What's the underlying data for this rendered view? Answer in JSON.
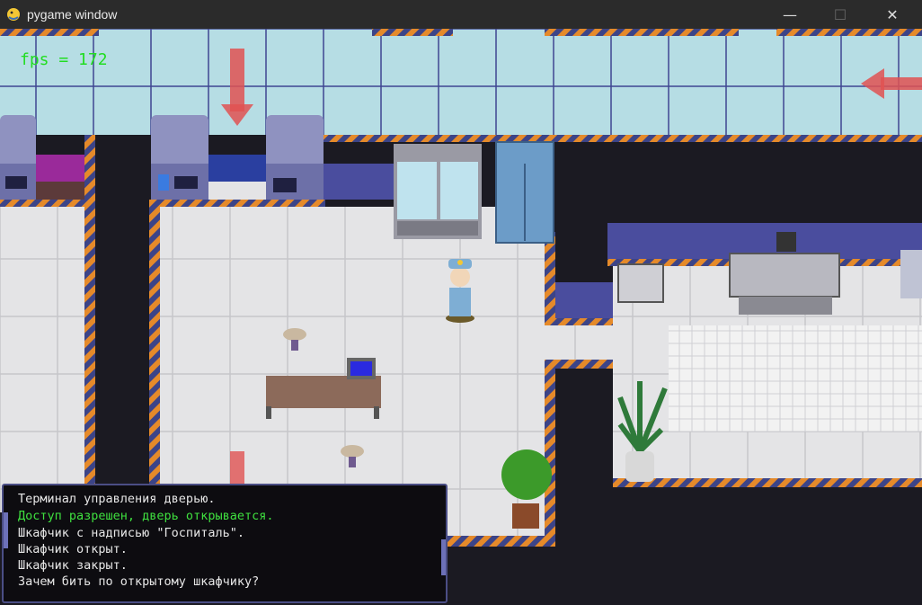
{
  "window": {
    "title": "pygame window",
    "minimize_glyph": "—",
    "maximize_glyph": "☐",
    "close_glyph": "✕"
  },
  "hud": {
    "fps_text": "fps = 172"
  },
  "console": {
    "lines": [
      {
        "text": "Терминал управления дверью.",
        "color": "#e6e6e6"
      },
      {
        "text": "Доступ разрешен, дверь открывается.",
        "color": "#3fe03f"
      },
      {
        "text": "Шкафчик с надписью \"Госпиталь\".",
        "color": "#e6e6e6"
      },
      {
        "text": "Шкафчик открыт.",
        "color": "#e6e6e6"
      },
      {
        "text": "Шкафчик закрыт.",
        "color": "#e6e6e6"
      },
      {
        "text": "Зачем бить по открытому шкафчику?",
        "color": "#e6e6e6"
      }
    ]
  },
  "colors": {
    "void": "#1b1a22",
    "floor": "#e4e4e6",
    "floor_grid": "#c6c6ca",
    "glass_floor": "#b6dde4",
    "glass_grid": "#3f4592",
    "hazard_orange": "#e58a2a",
    "hazard_blue": "#3c4488",
    "wall_blue": "#4a4d9e",
    "fps_green": "#22dd22",
    "console_green": "#3fe03f"
  },
  "icons": [
    "pygame-snake-icon",
    "down-arrow-marker",
    "left-arrow-marker"
  ]
}
